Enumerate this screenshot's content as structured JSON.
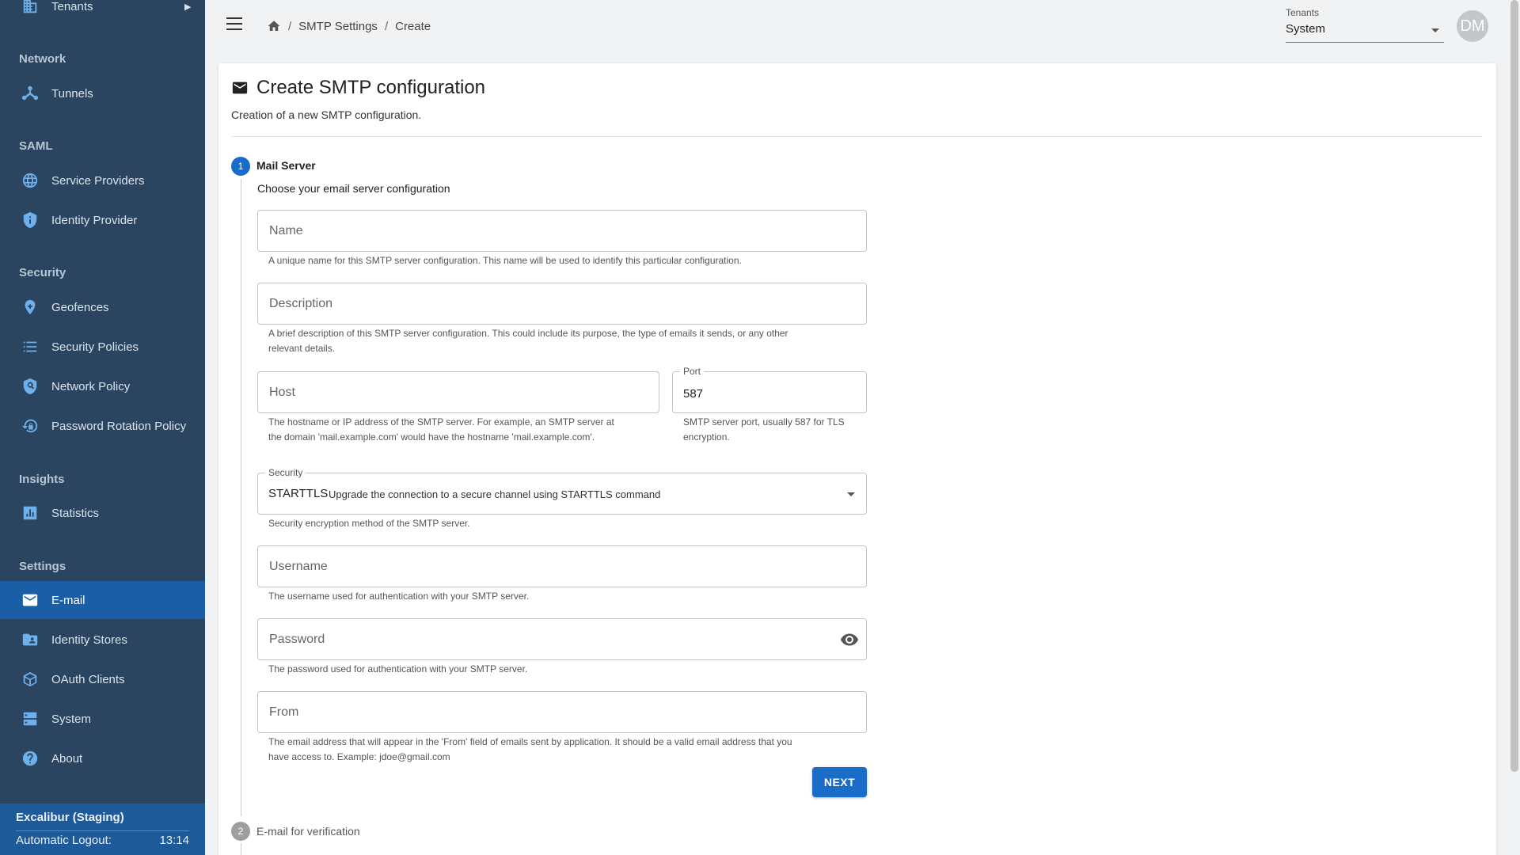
{
  "sidebar": {
    "top_item": {
      "label": "Tenants",
      "icon": "building-icon"
    },
    "sections": {
      "network": "Network",
      "saml": "SAML",
      "security": "Security",
      "insights": "Insights",
      "settings": "Settings"
    },
    "items": {
      "tunnels": "Tunnels",
      "service_providers": "Service Providers",
      "identity_provider": "Identity Provider",
      "geofences": "Geofences",
      "security_policies": "Security Policies",
      "network_policy": "Network Policy",
      "password_rotation_policy": "Password Rotation Policy",
      "statistics": "Statistics",
      "email": "E-mail",
      "identity_stores": "Identity Stores",
      "oauth_clients": "OAuth Clients",
      "system": "System",
      "about": "About"
    },
    "active_item": "email",
    "footer": {
      "title": "Excalibur (Staging)",
      "logout_label": "Automatic Logout:",
      "logout_time": "13:14"
    }
  },
  "topbar": {
    "breadcrumb": {
      "sep": "/",
      "items": [
        "SMTP Settings",
        "Create"
      ]
    },
    "tenants": {
      "label": "Tenants",
      "value": "System"
    },
    "avatar_initials": "DM"
  },
  "page": {
    "title": "Create SMTP configuration",
    "subtitle": "Creation of a new SMTP configuration.",
    "steps": [
      {
        "number": "1",
        "title": "Mail Server",
        "state": "active"
      },
      {
        "number": "2",
        "title": "E-mail for verification",
        "state": "inactive"
      }
    ],
    "step_description": "Choose your email server configuration",
    "fields": {
      "name": {
        "placeholder": "Name",
        "helper": "A unique name for this SMTP server configuration. This name will be used to identify this particular configuration."
      },
      "description": {
        "placeholder": "Description",
        "helper_line1": "A brief description of this SMTP server configuration. This could include its purpose, the type of emails it sends, or any other",
        "helper_line2": "relevant details."
      },
      "host": {
        "placeholder": "Host",
        "helper_line1": "The hostname or IP address of the SMTP server. For example, an SMTP server at",
        "helper_line2": "the domain 'mail.example.com' would have the hostname 'mail.example.com'."
      },
      "port": {
        "label": "Port",
        "value": "587",
        "helper_line1": "SMTP server port, usually 587 for TLS",
        "helper_line2": "encryption."
      },
      "security": {
        "label": "Security",
        "value": "STARTTLS",
        "value_description": "Upgrade the connection to a secure channel using STARTTLS command",
        "helper": "Security encryption method of the SMTP server."
      },
      "username": {
        "placeholder": "Username",
        "helper": "The username used for authentication with your SMTP server."
      },
      "password": {
        "placeholder": "Password",
        "helper": "The password used for authentication with your SMTP server."
      },
      "from": {
        "placeholder": "From",
        "helper_line1": "The email address that will appear in the 'From' field of emails sent by application. It should be a valid email address that you",
        "helper_line2": "have access to. Example: jdoe@gmail.com"
      }
    },
    "next_label": "NEXT"
  },
  "colors": {
    "sidebar_bg": "#2b4560",
    "sidebar_active": "#1a5fa6",
    "icon_blue": "#6db0ec",
    "primary": "#1a6cc9"
  }
}
